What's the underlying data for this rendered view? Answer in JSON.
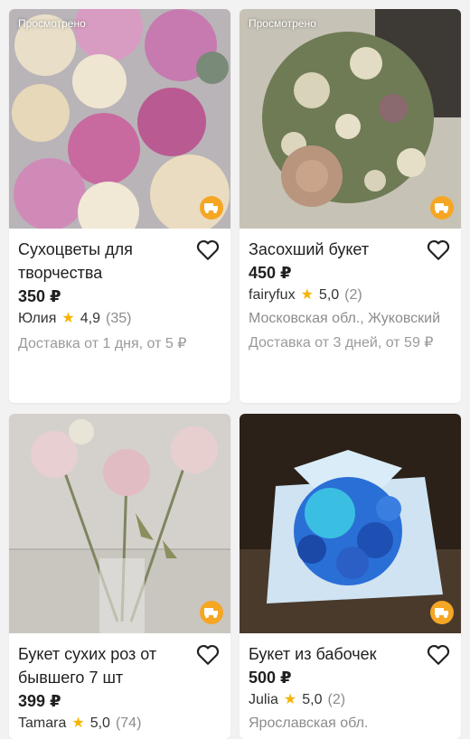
{
  "seen_label": "Просмотрено",
  "colors": {
    "accent": "#f5a623",
    "star": "#f6b400"
  },
  "listings": [
    {
      "title": "Сухоцветы для творчества",
      "price": "350 ₽",
      "seller": "Юлия",
      "rating": "4,9",
      "reviews": "(35)",
      "location": "",
      "delivery": "Доставка от 1 дня, от 5 ₽",
      "seen": "Просмотрено"
    },
    {
      "title": "Засохший букет",
      "price": "450 ₽",
      "seller": "fairyfux",
      "rating": "5,0",
      "reviews": "(2)",
      "location": "Московская обл., Жуковский",
      "delivery": "Доставка от 3 дней, от 59 ₽",
      "seen": "Просмотрено"
    },
    {
      "title": "Букет сухих роз от бывшего 7 шт",
      "price": "399 ₽",
      "seller": "Tamara",
      "rating": "5,0",
      "reviews": "(74)",
      "location": "",
      "delivery": "",
      "seen": ""
    },
    {
      "title": "Букет из бабочек",
      "price": "500 ₽",
      "seller": "Julia",
      "rating": "5,0",
      "reviews": "(2)",
      "location": "Ярославская обл.",
      "delivery": "",
      "seen": ""
    }
  ],
  "icons": {
    "favorite": "heart-outline-icon",
    "delivery": "truck-icon",
    "rating": "star-icon"
  }
}
